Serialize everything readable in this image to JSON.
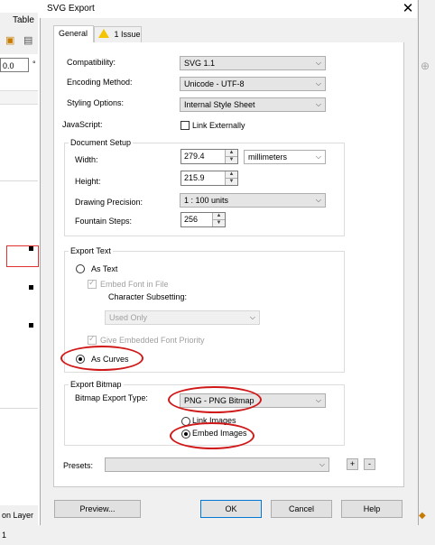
{
  "background": {
    "menu_label": "Table",
    "field_value": "0.0",
    "status_text": "on Layer 1"
  },
  "dialog": {
    "title": "SVG Export",
    "close_glyph": "✕",
    "tabs": [
      {
        "label": "General"
      },
      {
        "label": "1 Issue"
      }
    ],
    "compatibility": {
      "label": "Compatibility:",
      "value": "SVG 1.1"
    },
    "encoding": {
      "label": "Encoding Method:",
      "value": "Unicode - UTF-8"
    },
    "styling": {
      "label": "Styling Options:",
      "value": "Internal Style Sheet"
    },
    "javascript": {
      "label": "JavaScript:",
      "checkbox_label": "Link Externally"
    },
    "document_setup": {
      "title": "Document Setup",
      "width": {
        "label": "Width:",
        "value": "279.4"
      },
      "units": "millimeters",
      "height": {
        "label": "Height:",
        "value": "215.9"
      },
      "precision": {
        "label": "Drawing Precision:",
        "value": "1 : 100 units"
      },
      "fountain": {
        "label": "Fountain Steps:",
        "value": "256"
      }
    },
    "export_text": {
      "title": "Export Text",
      "as_text": "As Text",
      "embed_font": "Embed Font in File",
      "char_subsetting": "Character Subsetting:",
      "subset_value": "Used Only",
      "give_priority": "Give Embedded Font Priority",
      "as_curves": "As Curves"
    },
    "export_bitmap": {
      "title": "Export Bitmap",
      "type_label": "Bitmap Export Type:",
      "type_value": "PNG - PNG Bitmap",
      "link_images": "Link Images",
      "embed_images": "Embed Images"
    },
    "presets": {
      "label": "Presets:",
      "value": "",
      "add": "+",
      "remove": "-"
    },
    "buttons": {
      "preview": "Preview...",
      "ok": "OK",
      "cancel": "Cancel",
      "help": "Help"
    }
  },
  "colors": {
    "highlight": "#d01818",
    "default_button_border": "#0078d7"
  }
}
